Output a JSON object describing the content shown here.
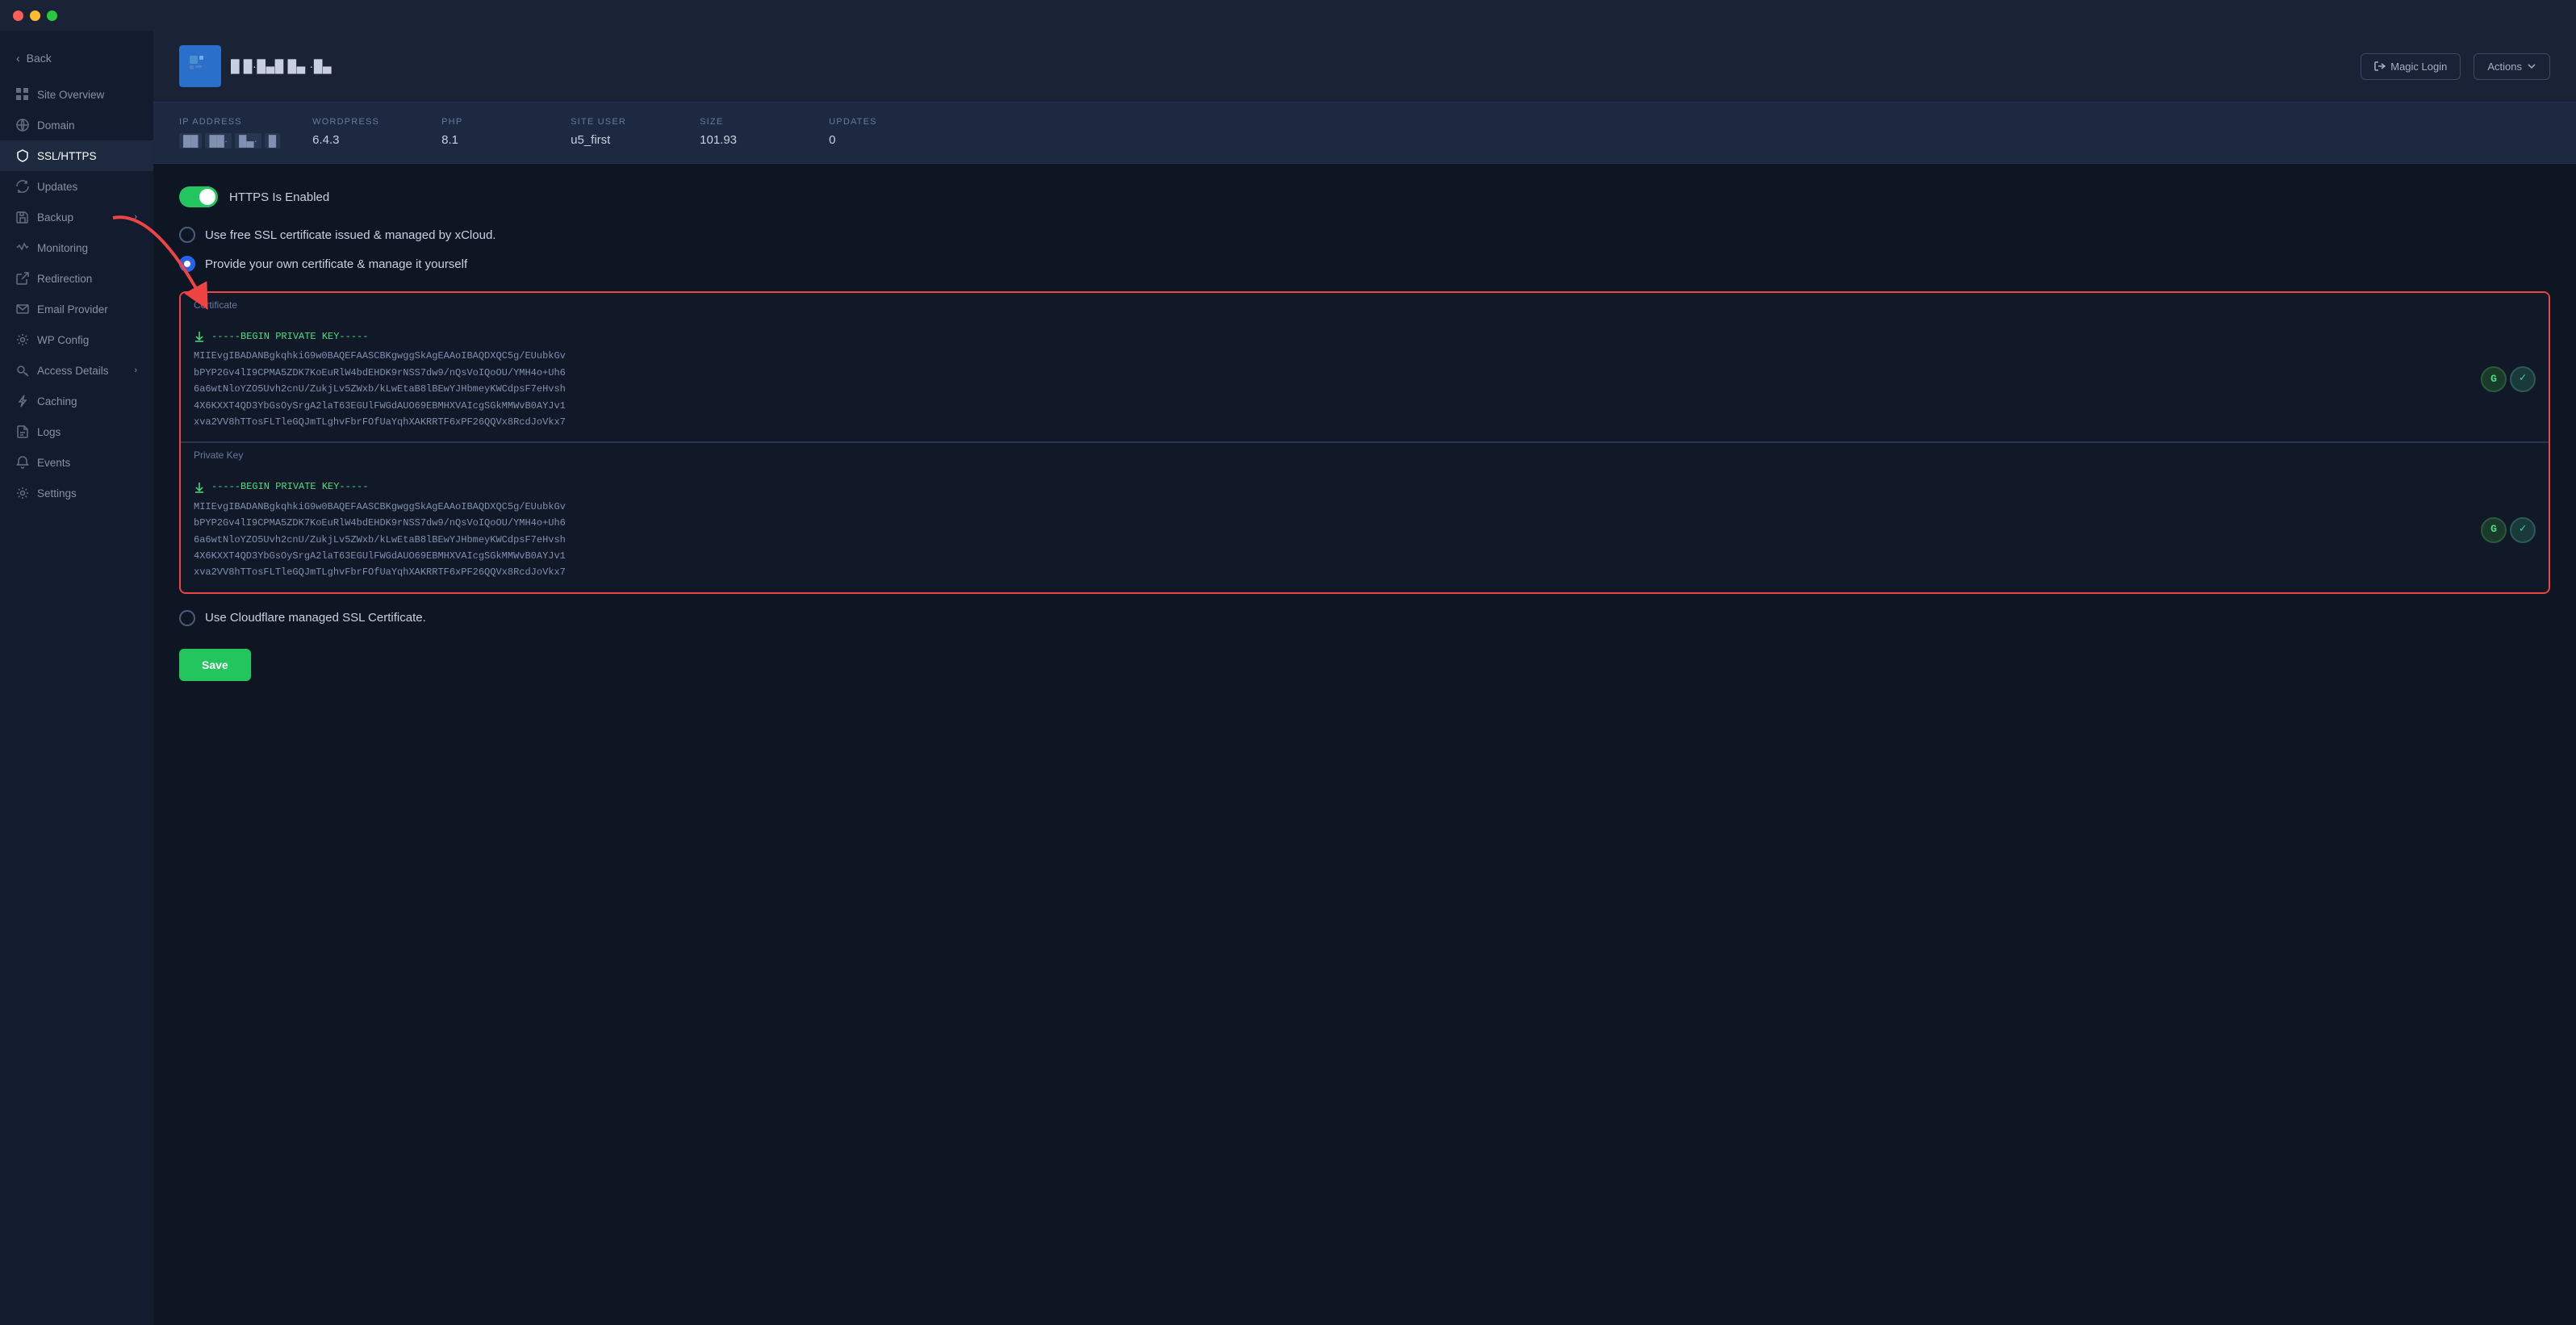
{
  "titlebar": {
    "dots": [
      "red",
      "yellow",
      "green"
    ]
  },
  "sidebar": {
    "back_label": "Back",
    "items": [
      {
        "id": "site-overview",
        "label": "Site Overview",
        "icon": "grid"
      },
      {
        "id": "domain",
        "label": "Domain",
        "icon": "globe"
      },
      {
        "id": "ssl-https",
        "label": "SSL/HTTPS",
        "icon": "shield",
        "active": true
      },
      {
        "id": "updates",
        "label": "Updates",
        "icon": "refresh"
      },
      {
        "id": "backup",
        "label": "Backup",
        "icon": "save",
        "has_chevron": true
      },
      {
        "id": "monitoring",
        "label": "Monitoring",
        "icon": "activity"
      },
      {
        "id": "redirection",
        "label": "Redirection",
        "icon": "external-link"
      },
      {
        "id": "email-provider",
        "label": "Email Provider",
        "icon": "mail"
      },
      {
        "id": "wp-config",
        "label": "WP Config",
        "icon": "settings"
      },
      {
        "id": "access-details",
        "label": "Access Details",
        "icon": "key",
        "has_chevron": true
      },
      {
        "id": "caching",
        "label": "Caching",
        "icon": "zap"
      },
      {
        "id": "logs",
        "label": "Logs",
        "icon": "file-text"
      },
      {
        "id": "events",
        "label": "Events",
        "icon": "bell"
      },
      {
        "id": "settings",
        "label": "Settings",
        "icon": "gear"
      }
    ]
  },
  "header": {
    "site_name": "█ █·█▄█ █▄ ·█▄",
    "magic_login_label": "Magic Login",
    "actions_label": "Actions"
  },
  "stats": [
    {
      "id": "ip-address",
      "label": "IP ADDRESS",
      "value": "█▌█·█▄·█"
    },
    {
      "id": "wordpress",
      "label": "WORDPRESS",
      "value": "6.4.3"
    },
    {
      "id": "php",
      "label": "PHP",
      "value": "8.1"
    },
    {
      "id": "site-user",
      "label": "SITE USER",
      "value": "u5_first"
    },
    {
      "id": "size",
      "label": "SIZE",
      "value": "101.93"
    },
    {
      "id": "updates",
      "label": "UPDATES",
      "value": "0"
    }
  ],
  "ssl": {
    "https_enabled_label": "HTTPS Is Enabled",
    "toggle_on": true,
    "options": [
      {
        "id": "free-ssl",
        "label": "Use free SSL certificate issued & managed by xCloud.",
        "selected": false
      },
      {
        "id": "own-cert",
        "label": "Provide your own certificate & manage it yourself",
        "selected": true
      }
    ],
    "certificate_label": "Certificate",
    "cert_begin_label": "-----BEGIN PRIVATE KEY-----",
    "cert_text": "MIIEvgIBADANBgkqhkiG9w0BAQEFAASCBKgwggSkAgEAAoIBAQDXQC5g/EUubkGv\nbPYP2Gv4lI9CPMA5ZDK7KoEuRlW4bdEHDK9rNSS7dw9/nQsVoIQoOU/YMH4o+Uh6\n6a6wtNloYZO5Uvh2cnU/ZukjLv5ZWxb/kLwEtaB8lBEwYJHbmeyKWCdpsF7eHvsh\n4X6KXXT4QD3YbGsOySrgA2laT63EGUlFWGdAUO69EBMHXVAIcgSGkMMWvB0AYJv1\nxva2VV8hTTosFLTleGQJmTLghvFbrFOfUaYqhXAKRRTF6xPF26QQVx8RcdJoVkx7",
    "private_key_label": "Private Key",
    "private_key_begin_label": "-----BEGIN PRIVATE KEY-----",
    "private_key_text": "MIIEvgIBADANBgkqhkiG9w0BAQEFAASCBKgwggSkAgEAAoIBAQDXQC5g/EUubkGv\nbPYP2Gv4lI9CPMA5ZDK7KoEuRlW4bdEHDK9rNSS7dw9/nQsVoIQoOU/YMH4o+Uh6\n6a6wtNloYZO5Uvh2cnU/ZukjLv5ZWxb/kLwEtaB8lBEwYJHbmeyKWCdpsF7eHvsh\n4X6KXXT4QD3YbGsOySrgA2laT63EGUlFWGdAUO69EBMHXVAIcgSGkMMWvB0AYJv1\nxva2VV8hTTosFLTleGQJmTLghvFbrFOfUaYqhXAKRRTF6xPF26QQVx8RcdJoVkx7",
    "cloudflare_label": "Use Cloudflare managed SSL Certificate.",
    "save_label": "Save"
  }
}
